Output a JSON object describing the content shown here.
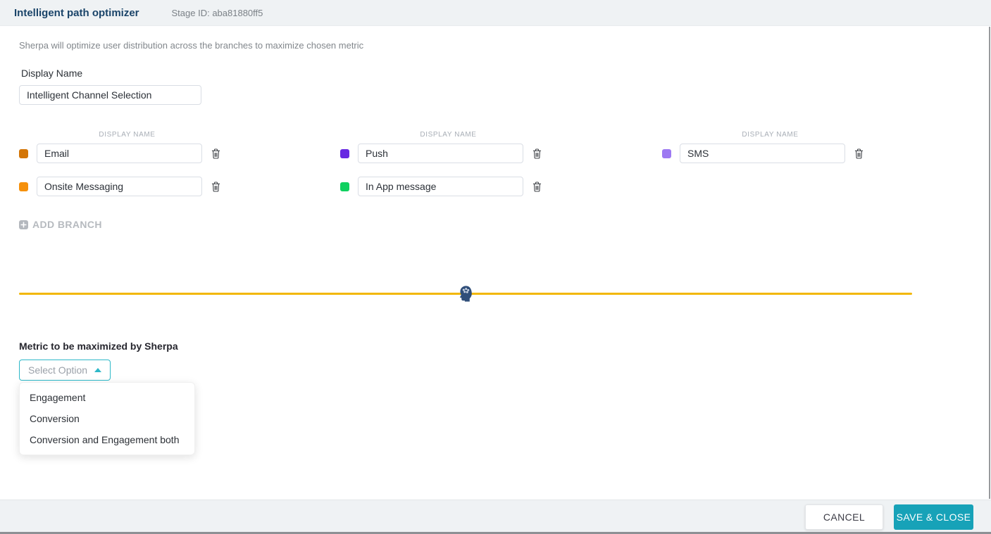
{
  "header": {
    "title": "Intelligent path optimizer",
    "stage_id": "Stage ID: aba81880ff5"
  },
  "description": "Sherpa will optimize user distribution across the branches to maximize chosen metric",
  "display_name": {
    "label": "Display Name",
    "value": "Intelligent Channel Selection"
  },
  "branches": {
    "column_header": "DISPLAY NAME",
    "items": [
      {
        "name": "Email",
        "color": "#d37506"
      },
      {
        "name": "Push",
        "color": "#6729e2"
      },
      {
        "name": "SMS",
        "color": "#9d79f2"
      },
      {
        "name": "Onsite Messaging",
        "color": "#f5900c"
      },
      {
        "name": "In App message",
        "color": "#0fd05f"
      }
    ],
    "add_branch_label": "ADD BRANCH"
  },
  "divider": {
    "color": "#f2b705",
    "icon": "brain-head-icon"
  },
  "metric": {
    "label": "Metric to be maximized by Sherpa",
    "placeholder": "Select Option",
    "options": [
      "Engagement",
      "Conversion",
      "Conversion and Engagement both"
    ]
  },
  "footer": {
    "cancel_label": "CANCEL",
    "save_label": "SAVE & CLOSE"
  },
  "colors": {
    "accent_teal": "#17a2b8",
    "dropdown_accent": "#2db8c8",
    "title_navy": "#1a4469"
  }
}
